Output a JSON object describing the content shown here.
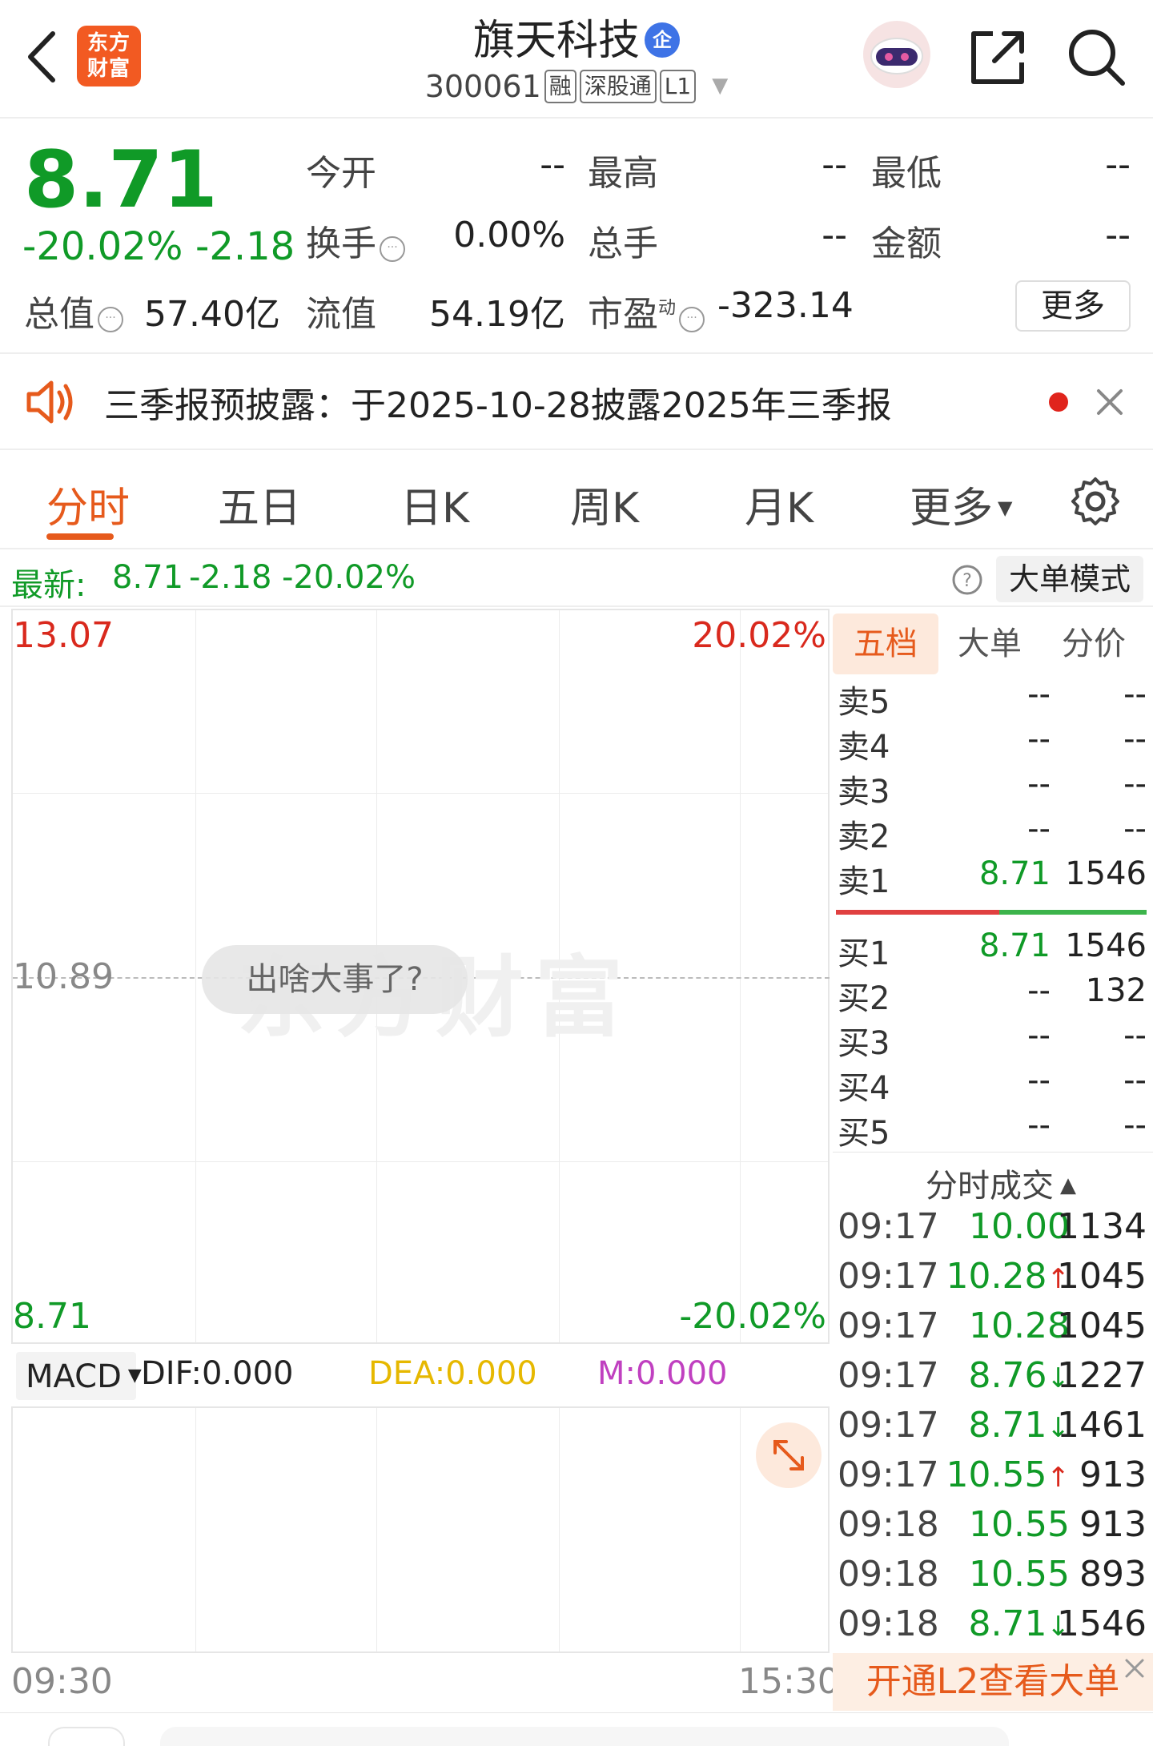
{
  "header": {
    "logo_text": "东方财富",
    "title": "旗天科技",
    "badge": "企",
    "code": "300061",
    "tags": [
      "融",
      "深股通",
      "L1"
    ]
  },
  "quote": {
    "price": "8.71",
    "change_pct": "-20.02%",
    "change": "-2.18",
    "fields": {
      "open_label": "今开",
      "open_value": "--",
      "high_label": "最高",
      "high_value": "--",
      "low_label": "最低",
      "low_value": "--",
      "turnover_label": "换手",
      "turnover_value": "0.00%",
      "volume_label": "总手",
      "volume_value": "--",
      "amount_label": "金额",
      "amount_value": "--",
      "mktcap_label": "总值",
      "mktcap_value": "57.40亿",
      "float_label": "流值",
      "float_value": "54.19亿",
      "pe_label": "市盈",
      "pe_sup": "动",
      "pe_value": "-323.14"
    },
    "more_label": "更多"
  },
  "notice": {
    "text": "三季报预披露：于2025-10-28披露2025年三季报"
  },
  "tabs": [
    "分时",
    "五日",
    "日K",
    "周K",
    "月K",
    "更多"
  ],
  "status": {
    "label": "最新:",
    "price": "8.71",
    "change": "-2.18",
    "pct": "-20.02%",
    "mode_button": "大单模式"
  },
  "chart": {
    "y_top": "13.07",
    "y_mid": "10.89",
    "y_bottom": "8.71",
    "pct_top": "20.02%",
    "pct_bottom": "-20.02%",
    "bubble": "出啥大事了?",
    "watermark": "东方财富",
    "time_start": "09:30",
    "time_end": "15:30"
  },
  "book": {
    "tabs": [
      "五档",
      "大单",
      "分价"
    ],
    "sells": [
      {
        "label": "卖5",
        "price": "--",
        "vol": "--"
      },
      {
        "label": "卖4",
        "price": "--",
        "vol": "--"
      },
      {
        "label": "卖3",
        "price": "--",
        "vol": "--"
      },
      {
        "label": "卖2",
        "price": "--",
        "vol": "--"
      },
      {
        "label": "卖1",
        "price": "8.71",
        "vol": "1546"
      }
    ],
    "buys": [
      {
        "label": "买1",
        "price": "8.71",
        "vol": "1546"
      },
      {
        "label": "买2",
        "price": "--",
        "vol": "132"
      },
      {
        "label": "买3",
        "price": "--",
        "vol": "--"
      },
      {
        "label": "买4",
        "price": "--",
        "vol": "--"
      },
      {
        "label": "买5",
        "price": "--",
        "vol": "--"
      }
    ],
    "trades_title": "分时成交",
    "trades": [
      {
        "time": "09:17",
        "price": "10.00",
        "arrow": "",
        "vol": "1134"
      },
      {
        "time": "09:17",
        "price": "10.28",
        "arrow": "↑",
        "vol": "1045"
      },
      {
        "time": "09:17",
        "price": "10.28",
        "arrow": "",
        "vol": "1045"
      },
      {
        "time": "09:17",
        "price": "8.76",
        "arrow": "↓",
        "vol": "1227"
      },
      {
        "time": "09:17",
        "price": "8.71",
        "arrow": "↓",
        "vol": "1461"
      },
      {
        "time": "09:17",
        "price": "10.55",
        "arrow": "↑",
        "vol": "913"
      },
      {
        "time": "09:18",
        "price": "10.55",
        "arrow": "",
        "vol": "913"
      },
      {
        "time": "09:18",
        "price": "10.55",
        "arrow": "",
        "vol": "893"
      },
      {
        "time": "09:18",
        "price": "8.71",
        "arrow": "↓",
        "vol": "1546"
      }
    ],
    "l2_banner": "开通L2查看大单"
  },
  "macd": {
    "selector": "MACD",
    "dif": "DIF:0.000",
    "dea": "DEA:0.000",
    "m": "M:0.000"
  },
  "colors": {
    "up": "#d9291d",
    "down": "#109a27",
    "accent": "#e65a1c",
    "dea": "#e6b800",
    "m": "#c040c0"
  }
}
